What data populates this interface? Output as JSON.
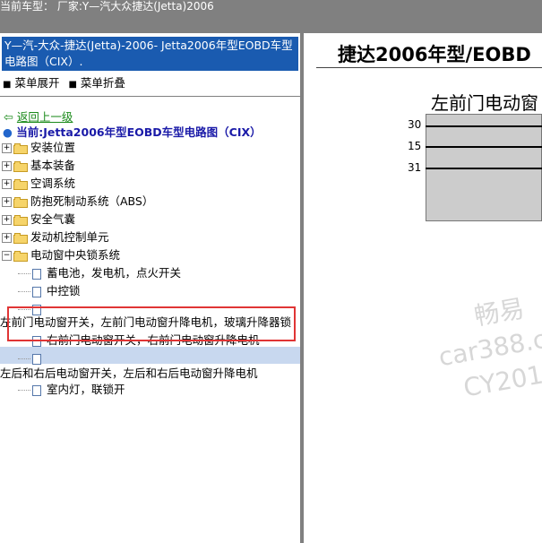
{
  "topbar": {
    "text": "当前车型： 厂家:Y—汽大众捷达(Jetta)2006"
  },
  "left": {
    "selected_title": "Y—汽-大众-捷达(Jetta)-2006- Jetta2006年型EOBD车型电路图（CIX）.",
    "menu_expand": "菜单展开",
    "menu_collapse": "菜单折叠",
    "back_label": "返回上一级",
    "current_label": "当前:Jetta2006年型EOBD车型电路图（CIX）",
    "folders": [
      {
        "label": "安装位置"
      },
      {
        "label": "基本装备"
      },
      {
        "label": "空调系统"
      },
      {
        "label": "防抱死制动系统（ABS）"
      },
      {
        "label": "安全气囊"
      },
      {
        "label": "发动机控制单元"
      },
      {
        "label": "电动窗中央锁系统"
      }
    ],
    "children": [
      {
        "label": "蓄电池，发电机，点火开关"
      },
      {
        "label": "中控锁"
      },
      {
        "label": ""
      },
      {
        "label": "左前门电动窗开关，左前门电动窗升降电机，玻璃升降器锁"
      },
      {
        "label": "右前门电动窗开关，右前门电动窗升降电机"
      },
      {
        "label": ""
      },
      {
        "label": "左后和右后电动窗开关，左后和右后电动窗升降电机"
      },
      {
        "label": "室内灯，联锁开"
      }
    ]
  },
  "right": {
    "title": "捷达2006年型/EOBD",
    "subtitle": "左前门电动窗",
    "pins": [
      "30",
      "15",
      "31"
    ]
  },
  "watermark": {
    "line1": "畅易",
    "line2": "car388.c",
    "line3": "CY201"
  }
}
